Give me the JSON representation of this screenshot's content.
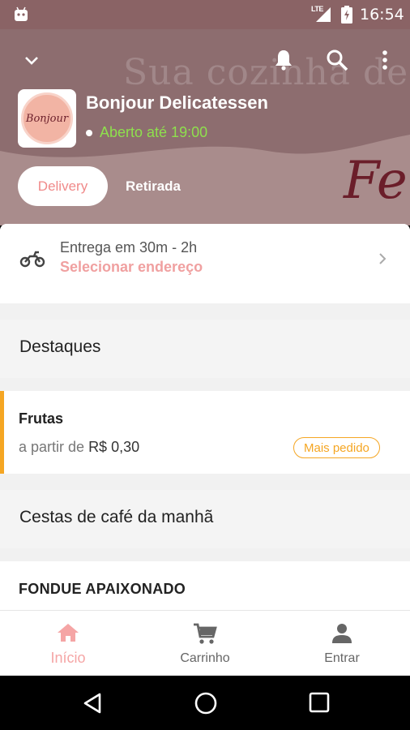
{
  "status_bar": {
    "network": "LTE",
    "time": "16:54"
  },
  "header": {
    "background_text": "Sua cozinha de",
    "background_script": "Feito",
    "store_name": "Bonjour Delicatessen",
    "logo_text": "Bonjour",
    "open_status": "Aberto até 19:00",
    "colors": {
      "open": "#8ee04d",
      "accent": "#f08a8a",
      "header_bg": "#8d6d6f"
    }
  },
  "order_mode": {
    "delivery_label": "Delivery",
    "pickup_label": "Retirada",
    "selected": "Delivery"
  },
  "delivery_card": {
    "time_text": "Entrega em 30m - 2h",
    "address_link": "Selecionar endereço"
  },
  "sections": {
    "highlights_title": "Destaques",
    "breakfast_title": "Cestas de café da manhã",
    "fondue_title": "FONDUE APAIXONADO"
  },
  "highlight_product": {
    "name": "Frutas",
    "from_label": "a partir de",
    "price": "R$ 0,30",
    "badge": "Mais pedido",
    "badge_color": "#f5a623"
  },
  "bottom_nav": {
    "items": [
      {
        "label": "Início",
        "icon": "home-icon"
      },
      {
        "label": "Carrinho",
        "icon": "cart-icon"
      },
      {
        "label": "Entrar",
        "icon": "person-icon"
      }
    ],
    "active": "Início"
  }
}
